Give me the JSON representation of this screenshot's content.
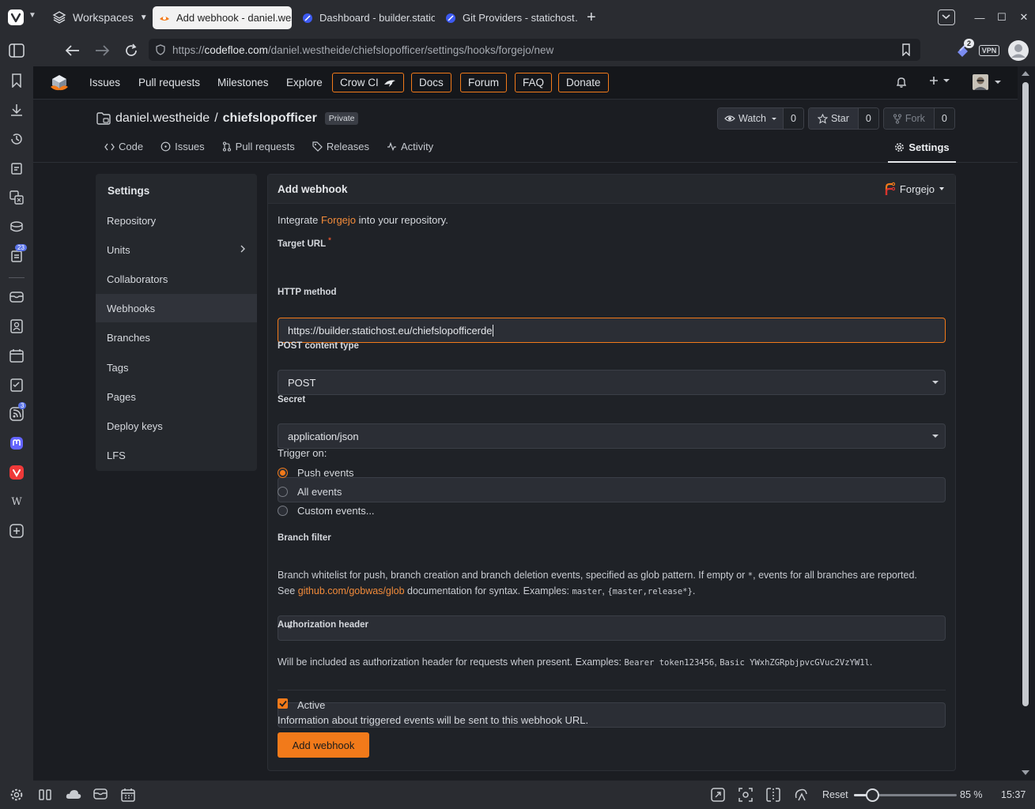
{
  "browser": {
    "workspaces_label": "Workspaces",
    "tabs": [
      {
        "title": "Add webhook - daniel.westl"
      },
      {
        "title": "Dashboard - builder.statio…"
      },
      {
        "title": "Git Providers - statichost…"
      }
    ],
    "url": {
      "prefix": "https://",
      "host": "codefloe.com",
      "path": "/daniel.westheide/chiefslopofficer/settings/hooks/forgejo/new"
    },
    "extension_badge": "2",
    "vpn_label": "VPN",
    "panel_badges": {
      "mail": "23",
      "feed": "3"
    },
    "panel_wiki": "W"
  },
  "statusbar": {
    "reset_label": "Reset",
    "zoom_label": "85 %",
    "zoom_fraction": 0.18,
    "clock": "15:37"
  },
  "topnav": {
    "items": [
      "Issues",
      "Pull requests",
      "Milestones",
      "Explore"
    ],
    "boxed": [
      "Crow CI",
      "Docs",
      "Forum",
      "FAQ",
      "Donate"
    ]
  },
  "repo": {
    "owner": "daniel.westheide",
    "separator": "/",
    "name": "chiefslopofficer",
    "visibility": "Private",
    "watch_label": "Watch",
    "watch_count": "0",
    "star_label": "Star",
    "star_count": "0",
    "fork_label": "Fork",
    "fork_count": "0",
    "tabs": [
      "Code",
      "Issues",
      "Pull requests",
      "Releases",
      "Activity"
    ],
    "settings_tab": "Settings"
  },
  "settings_menu": {
    "title": "Settings",
    "items": [
      "Repository",
      "Units",
      "Collaborators",
      "Webhooks",
      "Branches",
      "Tags",
      "Pages",
      "Deploy keys",
      "LFS"
    ],
    "active": "Webhooks"
  },
  "form": {
    "title": "Add webhook",
    "type_selector": "Forgejo",
    "intro_prefix": "Integrate ",
    "intro_link": "Forgejo",
    "intro_suffix": " into your repository.",
    "target_url_label": "Target URL",
    "required_mark": "*",
    "target_url_value": "https://builder.statichost.eu/chiefslopofficerde",
    "http_method_label": "HTTP method",
    "http_method_value": "POST",
    "content_type_label": "POST content type",
    "content_type_value": "application/json",
    "secret_label": "Secret",
    "secret_value": "",
    "trigger_label": "Trigger on:",
    "trigger_options": [
      "Push events",
      "All events",
      "Custom events..."
    ],
    "trigger_selected": "Push events",
    "branch_filter_label": "Branch filter",
    "branch_filter_value": "*",
    "branch_help": {
      "line1": "Branch whitelist for push, branch creation and branch deletion events, specified as glob pattern. If empty or ",
      "code1": "*",
      "line1_end": ", events for all branches are reported.",
      "see": "See ",
      "link": "github.com/gobwas/glob",
      "mid": " documentation for syntax. Examples: ",
      "ex1": "master",
      "comma": ", ",
      "ex2": "{master,release*}",
      "end": "."
    },
    "auth_header_label": "Authorization header",
    "auth_header_value": "",
    "auth_help": {
      "text": "Will be included as authorization header for requests when present. Examples: ",
      "ex1": "Bearer token123456",
      "comma": ", ",
      "ex2": "Basic YWxhZGRpbjpvcGVuc2VzYW1l",
      "end": "."
    },
    "active_label": "Active",
    "active_checked": true,
    "active_help": "Information about triggered events will be sent to this webhook URL.",
    "submit_label": "Add webhook"
  },
  "colors": {
    "accent": "#f27a1a",
    "link": "#f28b3a",
    "page_bg": "#1b1d22"
  }
}
